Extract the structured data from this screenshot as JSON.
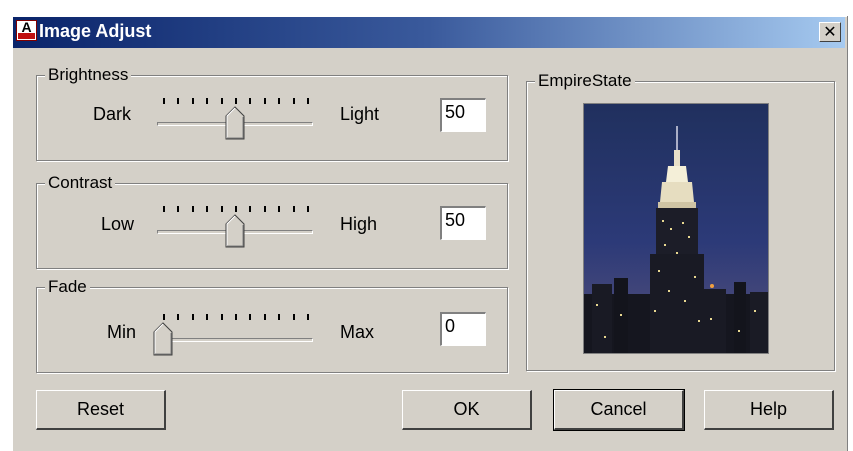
{
  "window": {
    "title": "Image Adjust",
    "close_glyph": "✕",
    "icon": "autocad-app-icon"
  },
  "brightness": {
    "label": "Brightness",
    "min_label": "Dark",
    "max_label": "Light",
    "value": "50",
    "level": 0.5
  },
  "contrast": {
    "label": "Contrast",
    "min_label": "Low",
    "max_label": "High",
    "value": "50",
    "level": 0.5
  },
  "fade": {
    "label": "Fade",
    "min_label": "Min",
    "max_label": "Max",
    "value": "0",
    "level": 0
  },
  "preview": {
    "label": "EmpireState",
    "image": "empire-state-building-night-photo"
  },
  "buttons": {
    "reset": "Reset",
    "ok": "OK",
    "cancel": "Cancel",
    "help": "Help"
  },
  "colors": {
    "titlebar_start": "#0a246a",
    "titlebar_end": "#a6caf0",
    "dialog_bg": "#d4d0c8"
  }
}
